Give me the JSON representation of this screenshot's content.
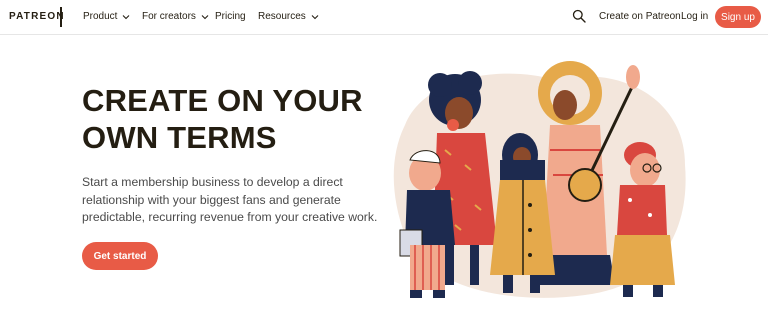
{
  "nav": {
    "logo": "PATREON",
    "items": [
      {
        "label": "Product",
        "has_dropdown": true
      },
      {
        "label": "For creators",
        "has_dropdown": true
      },
      {
        "label": "Pricing",
        "has_dropdown": false
      },
      {
        "label": "Resources",
        "has_dropdown": true
      }
    ],
    "search_icon": "search-icon",
    "create_link": "Create on Patreon",
    "login": "Log in",
    "signup": "Sign up"
  },
  "hero": {
    "title_lines": [
      "CREATE ON YOUR",
      "OWN TERMS"
    ],
    "subtitle_lines": [
      "Start a membership business to develop a direct",
      "relationship with your biggest fans and generate",
      "predictable, recurring revenue from your creative work."
    ],
    "cta": "Get started"
  },
  "colors": {
    "brand": "#e85b46",
    "text_dark": "#241e12",
    "text_body": "#4a4a4a",
    "blob": "#f3e6dc",
    "navy": "#1d2a4f",
    "mustard": "#e5a94b",
    "red": "#d9473f",
    "pink": "#f1a98d"
  }
}
